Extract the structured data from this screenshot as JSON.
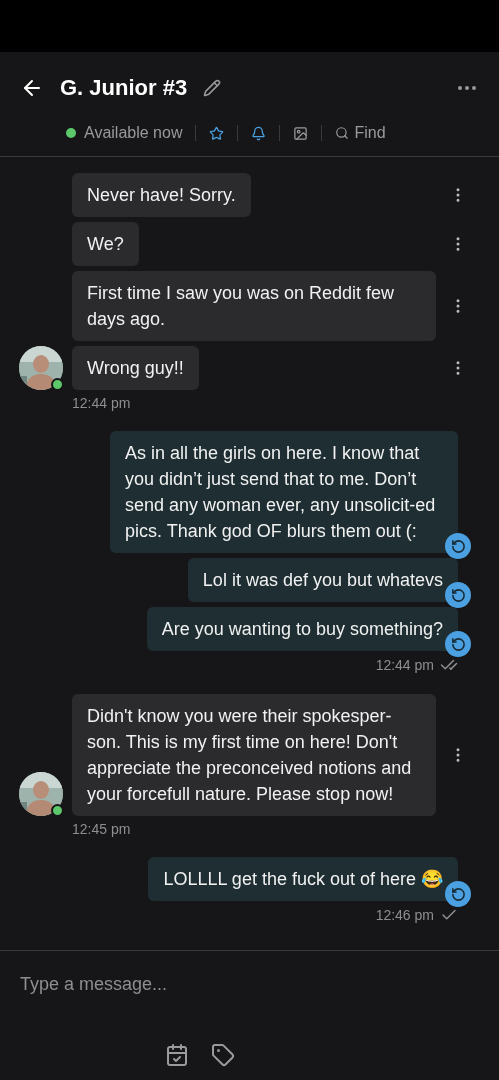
{
  "header": {
    "title": "G. Junior #3",
    "status": {
      "label": "Available now",
      "online": true
    },
    "find": "Find"
  },
  "messages": [
    {
      "kind": "incoming",
      "online": true,
      "bubbles": [
        "Never have! Sorry.",
        "We?",
        "First time I saw you was on Reddit few days ago.",
        "Wrong guy!!"
      ],
      "time": "12:44 pm"
    },
    {
      "kind": "outgoing",
      "bubbles": [
        "As in all the girls on here. I know that you didn’t just send that to me. Don’t send any woman ever, any unsolicit-ed pics. Thank god OF blurs them out (:",
        "Lol it was def you but whatevs",
        "Are you wanting to buy something?"
      ],
      "time": "12:44 pm",
      "read": true
    },
    {
      "kind": "incoming",
      "online": true,
      "bubbles": [
        "Didn't know you were their spokesper-son. This is my first time on here! Don't appreciate the preconceived notions and your forcefull nature. Please stop now!"
      ],
      "time": "12:45 pm"
    },
    {
      "kind": "outgoing",
      "bubbles": [
        "LOLLLL get the fuck out of here 😂"
      ],
      "time": "12:46 pm",
      "read": false
    }
  ],
  "composer": {
    "placeholder": "Type a message..."
  }
}
